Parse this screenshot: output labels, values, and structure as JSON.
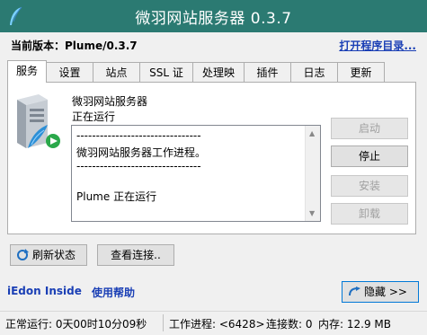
{
  "window": {
    "title": "微羽网站服务器 0.3.7"
  },
  "header": {
    "version_label": "当前版本：Plume/0.3.7",
    "open_dir_link": "打开程序目录..."
  },
  "tabs": [
    {
      "label": "服务",
      "active": true
    },
    {
      "label": "设置"
    },
    {
      "label": "站点"
    },
    {
      "label": "SSL 证书"
    },
    {
      "label": "处理映射"
    },
    {
      "label": "插件"
    },
    {
      "label": "日志"
    },
    {
      "label": "更新"
    }
  ],
  "service": {
    "name": "微羽网站服务器",
    "status": "正在运行",
    "log_lines": [
      "--------------------------------",
      "微羽网站服务器工作进程。",
      "--------------------------------",
      "",
      "Plume 正在运行"
    ],
    "buttons": {
      "start": "启动",
      "stop": "停止",
      "install": "安装",
      "uninstall": "卸载"
    },
    "refresh_button": "刷新状态",
    "view_connections_button": "查看连接.."
  },
  "footer": {
    "brand_link": "iEdon Inside",
    "help_link": "使用帮助",
    "hide_button": "隐藏 >>"
  },
  "statusbar": {
    "uptime": "正常运行: 0天00时10分09秒",
    "worker": "工作进程: <6428>",
    "connections": "连接数: 0",
    "memory": "内存: 12.9 MB"
  },
  "colors": {
    "titlebar": "#2b7a72",
    "link": "#1a3fb5"
  }
}
